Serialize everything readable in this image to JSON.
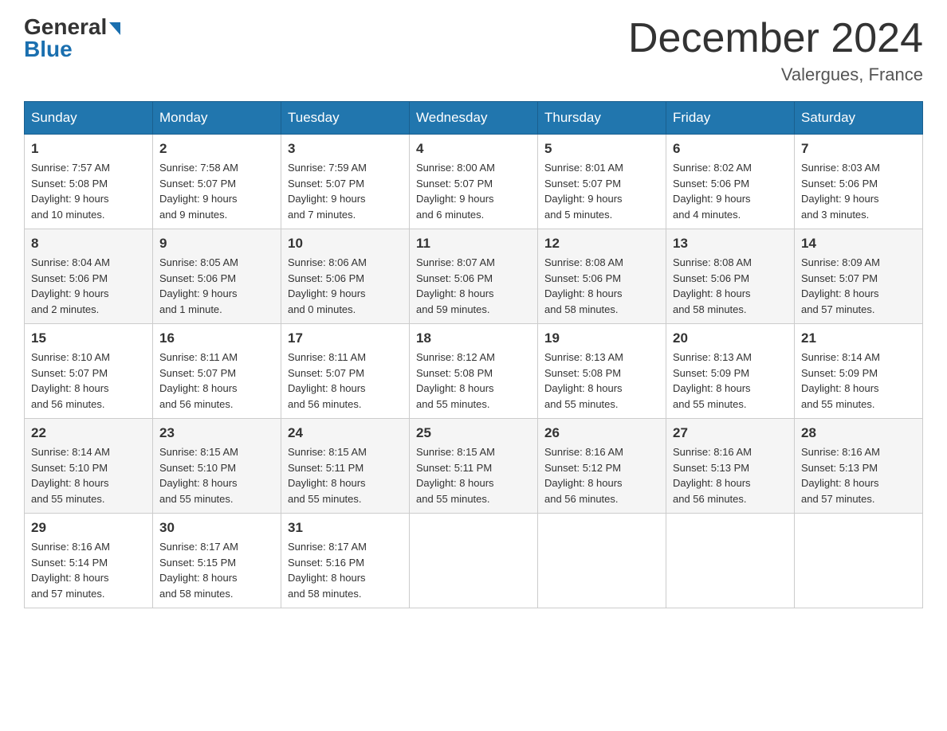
{
  "header": {
    "logo_general": "General",
    "logo_blue": "Blue",
    "month_title": "December 2024",
    "location": "Valergues, France"
  },
  "days_of_week": [
    "Sunday",
    "Monday",
    "Tuesday",
    "Wednesday",
    "Thursday",
    "Friday",
    "Saturday"
  ],
  "weeks": [
    [
      {
        "day": "1",
        "info": "Sunrise: 7:57 AM\nSunset: 5:08 PM\nDaylight: 9 hours\nand 10 minutes."
      },
      {
        "day": "2",
        "info": "Sunrise: 7:58 AM\nSunset: 5:07 PM\nDaylight: 9 hours\nand 9 minutes."
      },
      {
        "day": "3",
        "info": "Sunrise: 7:59 AM\nSunset: 5:07 PM\nDaylight: 9 hours\nand 7 minutes."
      },
      {
        "day": "4",
        "info": "Sunrise: 8:00 AM\nSunset: 5:07 PM\nDaylight: 9 hours\nand 6 minutes."
      },
      {
        "day": "5",
        "info": "Sunrise: 8:01 AM\nSunset: 5:07 PM\nDaylight: 9 hours\nand 5 minutes."
      },
      {
        "day": "6",
        "info": "Sunrise: 8:02 AM\nSunset: 5:06 PM\nDaylight: 9 hours\nand 4 minutes."
      },
      {
        "day": "7",
        "info": "Sunrise: 8:03 AM\nSunset: 5:06 PM\nDaylight: 9 hours\nand 3 minutes."
      }
    ],
    [
      {
        "day": "8",
        "info": "Sunrise: 8:04 AM\nSunset: 5:06 PM\nDaylight: 9 hours\nand 2 minutes."
      },
      {
        "day": "9",
        "info": "Sunrise: 8:05 AM\nSunset: 5:06 PM\nDaylight: 9 hours\nand 1 minute."
      },
      {
        "day": "10",
        "info": "Sunrise: 8:06 AM\nSunset: 5:06 PM\nDaylight: 9 hours\nand 0 minutes."
      },
      {
        "day": "11",
        "info": "Sunrise: 8:07 AM\nSunset: 5:06 PM\nDaylight: 8 hours\nand 59 minutes."
      },
      {
        "day": "12",
        "info": "Sunrise: 8:08 AM\nSunset: 5:06 PM\nDaylight: 8 hours\nand 58 minutes."
      },
      {
        "day": "13",
        "info": "Sunrise: 8:08 AM\nSunset: 5:06 PM\nDaylight: 8 hours\nand 58 minutes."
      },
      {
        "day": "14",
        "info": "Sunrise: 8:09 AM\nSunset: 5:07 PM\nDaylight: 8 hours\nand 57 minutes."
      }
    ],
    [
      {
        "day": "15",
        "info": "Sunrise: 8:10 AM\nSunset: 5:07 PM\nDaylight: 8 hours\nand 56 minutes."
      },
      {
        "day": "16",
        "info": "Sunrise: 8:11 AM\nSunset: 5:07 PM\nDaylight: 8 hours\nand 56 minutes."
      },
      {
        "day": "17",
        "info": "Sunrise: 8:11 AM\nSunset: 5:07 PM\nDaylight: 8 hours\nand 56 minutes."
      },
      {
        "day": "18",
        "info": "Sunrise: 8:12 AM\nSunset: 5:08 PM\nDaylight: 8 hours\nand 55 minutes."
      },
      {
        "day": "19",
        "info": "Sunrise: 8:13 AM\nSunset: 5:08 PM\nDaylight: 8 hours\nand 55 minutes."
      },
      {
        "day": "20",
        "info": "Sunrise: 8:13 AM\nSunset: 5:09 PM\nDaylight: 8 hours\nand 55 minutes."
      },
      {
        "day": "21",
        "info": "Sunrise: 8:14 AM\nSunset: 5:09 PM\nDaylight: 8 hours\nand 55 minutes."
      }
    ],
    [
      {
        "day": "22",
        "info": "Sunrise: 8:14 AM\nSunset: 5:10 PM\nDaylight: 8 hours\nand 55 minutes."
      },
      {
        "day": "23",
        "info": "Sunrise: 8:15 AM\nSunset: 5:10 PM\nDaylight: 8 hours\nand 55 minutes."
      },
      {
        "day": "24",
        "info": "Sunrise: 8:15 AM\nSunset: 5:11 PM\nDaylight: 8 hours\nand 55 minutes."
      },
      {
        "day": "25",
        "info": "Sunrise: 8:15 AM\nSunset: 5:11 PM\nDaylight: 8 hours\nand 55 minutes."
      },
      {
        "day": "26",
        "info": "Sunrise: 8:16 AM\nSunset: 5:12 PM\nDaylight: 8 hours\nand 56 minutes."
      },
      {
        "day": "27",
        "info": "Sunrise: 8:16 AM\nSunset: 5:13 PM\nDaylight: 8 hours\nand 56 minutes."
      },
      {
        "day": "28",
        "info": "Sunrise: 8:16 AM\nSunset: 5:13 PM\nDaylight: 8 hours\nand 57 minutes."
      }
    ],
    [
      {
        "day": "29",
        "info": "Sunrise: 8:16 AM\nSunset: 5:14 PM\nDaylight: 8 hours\nand 57 minutes."
      },
      {
        "day": "30",
        "info": "Sunrise: 8:17 AM\nSunset: 5:15 PM\nDaylight: 8 hours\nand 58 minutes."
      },
      {
        "day": "31",
        "info": "Sunrise: 8:17 AM\nSunset: 5:16 PM\nDaylight: 8 hours\nand 58 minutes."
      },
      {
        "day": "",
        "info": ""
      },
      {
        "day": "",
        "info": ""
      },
      {
        "day": "",
        "info": ""
      },
      {
        "day": "",
        "info": ""
      }
    ]
  ]
}
